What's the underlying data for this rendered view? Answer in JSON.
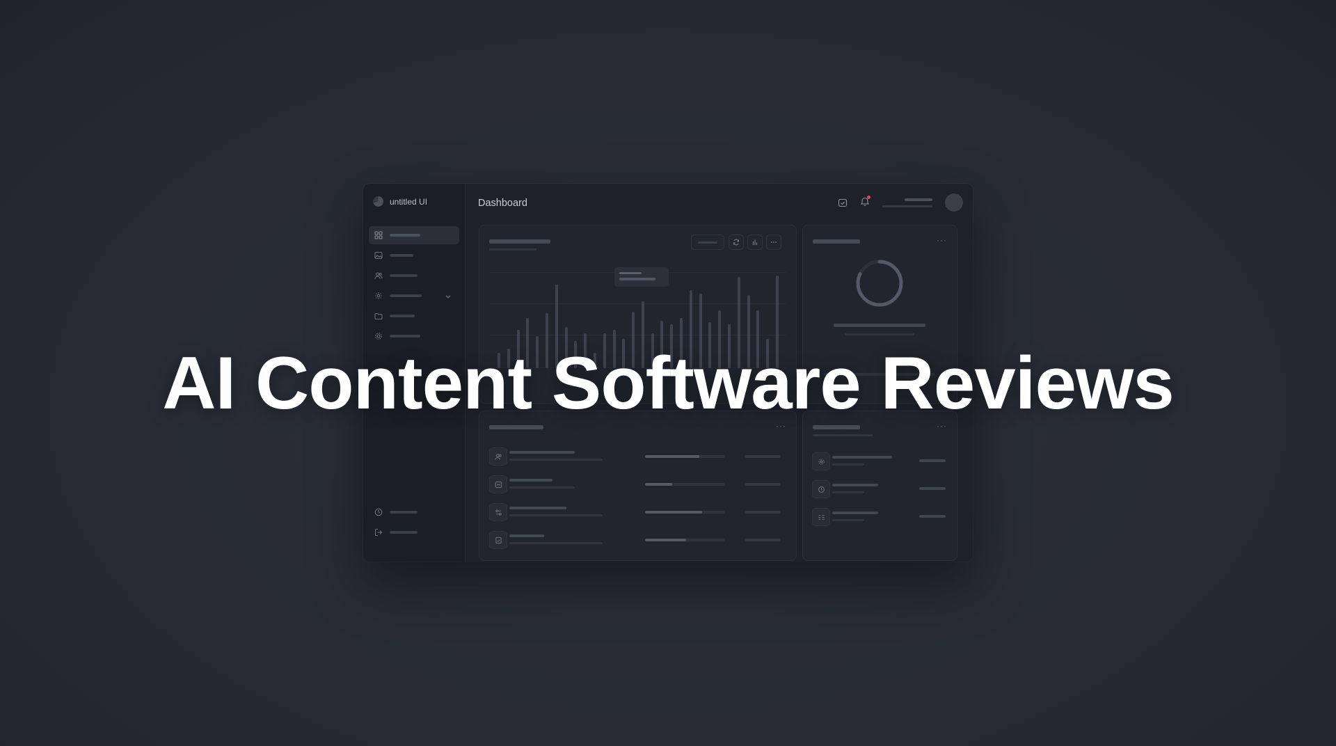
{
  "app": {
    "brand_name": "untitled UI",
    "page_title": "Dashboard"
  },
  "headline": "AI Content Software Reviews",
  "sidebar": {
    "items": [
      {
        "icon": "grid-icon",
        "active": true
      },
      {
        "icon": "image-icon",
        "active": false
      },
      {
        "icon": "users-icon",
        "active": false
      },
      {
        "icon": "settings-icon",
        "active": false,
        "expandable": true
      },
      {
        "icon": "folder-icon",
        "active": false
      },
      {
        "icon": "gear-icon",
        "active": false
      }
    ],
    "bottom_items": [
      {
        "icon": "clock-icon"
      },
      {
        "icon": "logout-icon"
      }
    ]
  },
  "topbar": {
    "icons": [
      "calendar-icon",
      "bell-icon"
    ],
    "notification_dot_color": "#e24b4b"
  },
  "chart_data": {
    "type": "bar",
    "values": [
      10,
      13,
      25,
      33,
      21,
      36,
      55,
      27,
      18,
      23,
      10,
      23,
      25,
      19,
      37,
      44,
      23,
      31,
      29,
      33,
      51,
      49,
      30,
      38,
      29,
      60,
      48,
      38,
      19,
      61
    ]
  },
  "donut": {
    "fill": 0.82
  },
  "colors": {
    "background": "#262b35",
    "window": "#1c2029",
    "card": "#20252e",
    "placeholder": "#3b414c"
  }
}
